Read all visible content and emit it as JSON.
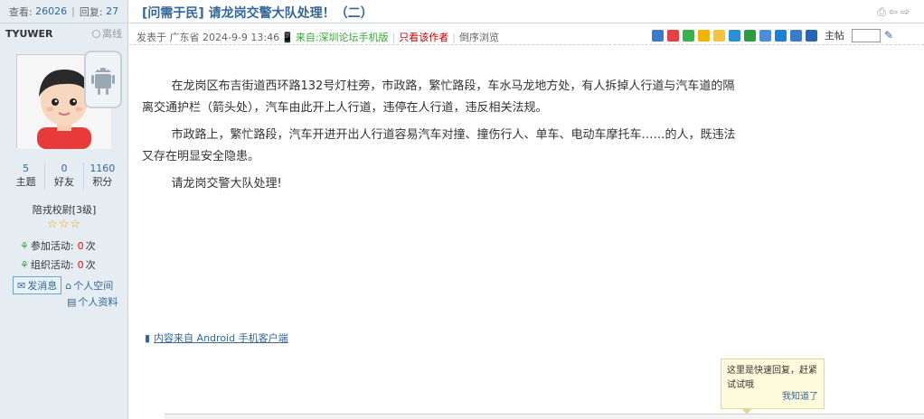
{
  "left": {
    "views_label": "查看:",
    "views_value": "26026",
    "replies_label": "回复:",
    "replies_value": "27",
    "username": "TYUWER",
    "status": "离线",
    "counts": [
      {
        "value": "5",
        "label": "主题"
      },
      {
        "value": "0",
        "label": "好友"
      },
      {
        "value": "1160",
        "label": "积分"
      }
    ],
    "rank": "陪戎校尉[3级]",
    "stars": "☆☆☆",
    "activities": [
      {
        "label": "参加活动:",
        "value": "0",
        "unit": "次"
      },
      {
        "label": "组织活动:",
        "value": "0",
        "unit": "次"
      }
    ],
    "send_message": "发消息",
    "personal_space": "个人空间",
    "personal_profile": "个人资料"
  },
  "thread": {
    "title": "[问需于民] 请龙岗交警大队处理！（二）",
    "posted_in": "发表于 广东省 2024-9-9 13:46",
    "from_label": "来自:",
    "from_value": "深圳论坛手机版",
    "only_author": "只看该作者",
    "reverse_view": "倒序浏览",
    "floor_label": "主帖"
  },
  "content": {
    "paragraphs": [
      "在龙岗区布吉街道西环路132号灯柱旁，市政路，繁忙路段，车水马龙地方处，有人拆掉人行道与汽车道的隔离交通护栏（箭头处），汽车由此开上人行道，违停在人行道，违反相关法规。",
      "市政路上，繁忙路段，汽车开进开出人行道容易汽车对撞、撞伤行人、单车、电动车摩托车……的人，既违法又存在明显安全隐患。",
      "请龙岗交警大队处理!"
    ],
    "source": "内容来自 Android 手机客户端"
  },
  "tip": {
    "text": "这里是快速回复，赶紧试试哦",
    "confirm": "我知道了"
  },
  "share_icons": [
    "plus-icon",
    "weibo-icon",
    "wechat-icon",
    "qq-icon",
    "qzone-icon",
    "baidu-icon",
    "douban-icon",
    "renren-icon",
    "edit-icon",
    "plus-icon",
    "people-icon"
  ],
  "colors": {
    "link": "#336699",
    "sidebar": "#e5edf2",
    "border": "#c2d5e3"
  }
}
